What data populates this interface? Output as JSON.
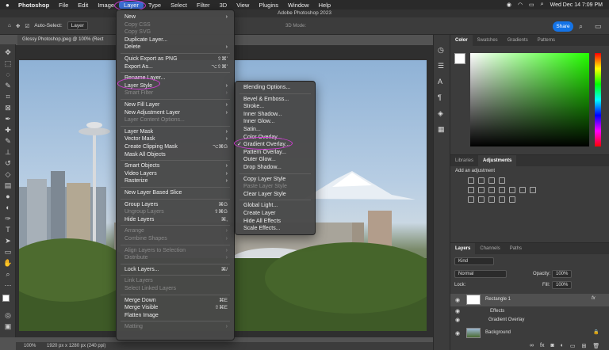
{
  "menubar": {
    "app": "Photoshop",
    "items": [
      "File",
      "Edit",
      "Image",
      "Layer",
      "Type",
      "Select",
      "Filter",
      "3D",
      "View",
      "Plugins",
      "Window",
      "Help"
    ],
    "clock": "Wed Dec 14  7:09 PM"
  },
  "window_title": "Adobe Photoshop 2023",
  "options": {
    "auto_select": "Auto-Select:",
    "layer_value": "Layer",
    "mode_3d": "3D Mode:",
    "share": "Share"
  },
  "document_tab": "Glossy Photoshop.jpeg @ 100% (Rect",
  "status": {
    "zoom": "100%",
    "dims": "1920 px x 1280 px (240 ppi)"
  },
  "layer_menu": {
    "items": [
      {
        "label": "New",
        "shortcut": "",
        "submenu": true,
        "enabled": true
      },
      {
        "label": "Copy CSS",
        "shortcut": "",
        "submenu": false,
        "enabled": false
      },
      {
        "label": "Copy SVG",
        "shortcut": "",
        "submenu": false,
        "enabled": false
      },
      {
        "label": "Duplicate Layer...",
        "shortcut": "",
        "submenu": false,
        "enabled": true
      },
      {
        "label": "Delete",
        "shortcut": "",
        "submenu": true,
        "enabled": true
      },
      {
        "sep": true
      },
      {
        "label": "Quick Export as PNG",
        "shortcut": "⇧⌘'",
        "submenu": false,
        "enabled": true
      },
      {
        "label": "Export As...",
        "shortcut": "⌥⇧⌘'",
        "submenu": false,
        "enabled": true
      },
      {
        "sep": true
      },
      {
        "label": "Rename Layer...",
        "shortcut": "",
        "submenu": false,
        "enabled": true
      },
      {
        "label": "Layer Style",
        "shortcut": "",
        "submenu": true,
        "enabled": true
      },
      {
        "label": "Smart Filter",
        "shortcut": "",
        "submenu": true,
        "enabled": false
      },
      {
        "sep": true
      },
      {
        "label": "New Fill Layer",
        "shortcut": "",
        "submenu": true,
        "enabled": true
      },
      {
        "label": "New Adjustment Layer",
        "shortcut": "",
        "submenu": true,
        "enabled": true
      },
      {
        "label": "Layer Content Options...",
        "shortcut": "",
        "submenu": false,
        "enabled": false
      },
      {
        "sep": true
      },
      {
        "label": "Layer Mask",
        "shortcut": "",
        "submenu": true,
        "enabled": true
      },
      {
        "label": "Vector Mask",
        "shortcut": "",
        "submenu": true,
        "enabled": true
      },
      {
        "label": "Create Clipping Mask",
        "shortcut": "⌥⌘G",
        "submenu": false,
        "enabled": true
      },
      {
        "label": "Mask All Objects",
        "shortcut": "",
        "submenu": false,
        "enabled": true
      },
      {
        "sep": true
      },
      {
        "label": "Smart Objects",
        "shortcut": "",
        "submenu": true,
        "enabled": true
      },
      {
        "label": "Video Layers",
        "shortcut": "",
        "submenu": true,
        "enabled": true
      },
      {
        "label": "Rasterize",
        "shortcut": "",
        "submenu": true,
        "enabled": true
      },
      {
        "sep": true
      },
      {
        "label": "New Layer Based Slice",
        "shortcut": "",
        "submenu": false,
        "enabled": true
      },
      {
        "sep": true
      },
      {
        "label": "Group Layers",
        "shortcut": "⌘G",
        "submenu": false,
        "enabled": true
      },
      {
        "label": "Ungroup Layers",
        "shortcut": "⇧⌘G",
        "submenu": false,
        "enabled": false
      },
      {
        "label": "Hide Layers",
        "shortcut": "⌘,",
        "submenu": false,
        "enabled": true
      },
      {
        "sep": true
      },
      {
        "label": "Arrange",
        "shortcut": "",
        "submenu": true,
        "enabled": false
      },
      {
        "label": "Combine Shapes",
        "shortcut": "",
        "submenu": true,
        "enabled": false
      },
      {
        "sep": true
      },
      {
        "label": "Align Layers to Selection",
        "shortcut": "",
        "submenu": true,
        "enabled": false
      },
      {
        "label": "Distribute",
        "shortcut": "",
        "submenu": true,
        "enabled": false
      },
      {
        "sep": true
      },
      {
        "label": "Lock Layers...",
        "shortcut": "⌘/",
        "submenu": false,
        "enabled": true
      },
      {
        "sep": true
      },
      {
        "label": "Link Layers",
        "shortcut": "",
        "submenu": false,
        "enabled": false
      },
      {
        "label": "Select Linked Layers",
        "shortcut": "",
        "submenu": false,
        "enabled": false
      },
      {
        "sep": true
      },
      {
        "label": "Merge Down",
        "shortcut": "⌘E",
        "submenu": false,
        "enabled": true
      },
      {
        "label": "Merge Visible",
        "shortcut": "⇧⌘E",
        "submenu": false,
        "enabled": true
      },
      {
        "label": "Flatten Image",
        "shortcut": "",
        "submenu": false,
        "enabled": true
      },
      {
        "sep": true
      },
      {
        "label": "Matting",
        "shortcut": "",
        "submenu": true,
        "enabled": false
      }
    ]
  },
  "layer_style_menu": {
    "items": [
      {
        "label": "Blending Options...",
        "enabled": true
      },
      {
        "sep": true
      },
      {
        "label": "Bevel & Emboss...",
        "enabled": true
      },
      {
        "label": "Stroke...",
        "enabled": true
      },
      {
        "label": "Inner Shadow...",
        "enabled": true
      },
      {
        "label": "Inner Glow...",
        "enabled": true
      },
      {
        "label": "Satin...",
        "enabled": true
      },
      {
        "label": "Color Overlay...",
        "enabled": true
      },
      {
        "label": "Gradient Overlay...",
        "enabled": true,
        "checked": true
      },
      {
        "label": "Pattern Overlay...",
        "enabled": true
      },
      {
        "label": "Outer Glow...",
        "enabled": true
      },
      {
        "label": "Drop Shadow...",
        "enabled": true
      },
      {
        "sep": true
      },
      {
        "label": "Copy Layer Style",
        "enabled": true
      },
      {
        "label": "Paste Layer Style",
        "enabled": false
      },
      {
        "label": "Clear Layer Style",
        "enabled": true
      },
      {
        "sep": true
      },
      {
        "label": "Global Light...",
        "enabled": true
      },
      {
        "label": "Create Layer",
        "enabled": true
      },
      {
        "label": "Hide All Effects",
        "enabled": true
      },
      {
        "label": "Scale Effects...",
        "enabled": true
      }
    ]
  },
  "panels": {
    "color_tabs": [
      "Color",
      "Swatches",
      "Gradients",
      "Patterns"
    ],
    "adj_tabs": [
      "Libraries",
      "Adjustments"
    ],
    "add_adjustment": "Add an adjustment",
    "layer_tabs": [
      "Layers",
      "Channels",
      "Paths"
    ],
    "kind": "Kind",
    "blend_mode": "Normal",
    "opacity_label": "Opacity:",
    "opacity_value": "100%",
    "lock_label": "Lock:",
    "fill_label": "Fill:",
    "fill_value": "100%",
    "layers": [
      {
        "name": "Rectangle 1",
        "fx": "fx"
      },
      {
        "name": "Effects"
      },
      {
        "name": "Gradient Overlay"
      },
      {
        "name": "Background"
      }
    ]
  },
  "colors": {
    "accent": "#1473e6",
    "highlight": "#3b6fd6",
    "annotation": "#d33cd6"
  }
}
